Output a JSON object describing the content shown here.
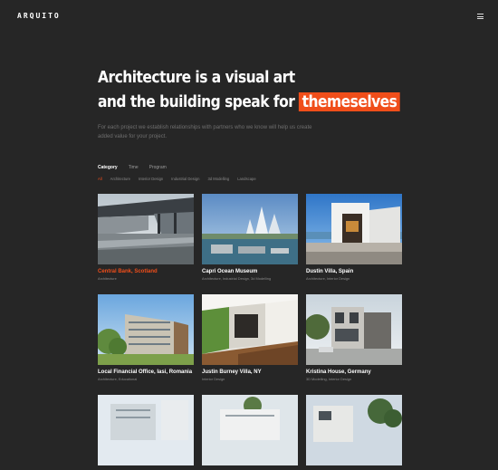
{
  "header": {
    "logo": "ARQUITO"
  },
  "hero": {
    "line1": "Architecture is a visual art",
    "line2_prefix": "and the building speak for",
    "line2_highlight": "themeselves",
    "subtitle": "For each project we establish relationships with partners who we know will help us create added value for your project."
  },
  "filters": {
    "tabs": [
      "Category",
      "Time",
      "Program"
    ],
    "categories": [
      "All",
      "Architecture",
      "Interior Design",
      "Industrial Design",
      "3d Modelling",
      "Landscape"
    ]
  },
  "projects": [
    {
      "title": "Central Bank, Scotland",
      "tags": "Architecture"
    },
    {
      "title": "Capri Ocean Museum",
      "tags": "Architecture, Industrial Design, 3d Modelling"
    },
    {
      "title": "Dustin Villa, Spain",
      "tags": "Architecture, Interior Design"
    },
    {
      "title": "Local Financial Office, Iasi, Romania",
      "tags": "Architecture, Educational"
    },
    {
      "title": "Justin Burney Villa, NY",
      "tags": "Interior Design"
    },
    {
      "title": "Kristina House, Germany",
      "tags": "3D Modelling, Interior Design"
    },
    {
      "title": "",
      "tags": ""
    },
    {
      "title": "",
      "tags": ""
    },
    {
      "title": "",
      "tags": ""
    }
  ],
  "colors": {
    "accent": "#f04e1a",
    "background": "#262626"
  },
  "icons": {
    "menu": "hamburger-menu-icon"
  }
}
